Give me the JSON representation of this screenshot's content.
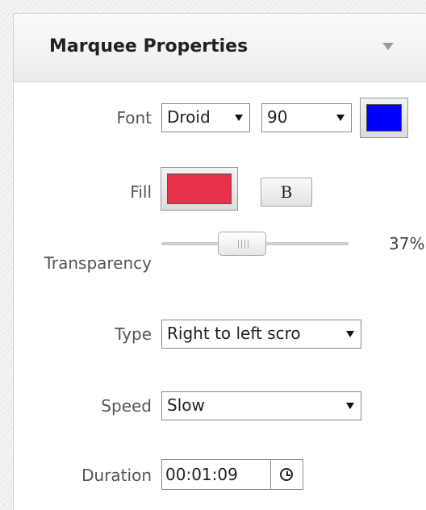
{
  "panel": {
    "title": "Marquee Properties"
  },
  "font": {
    "label": "Font",
    "family": "Droid",
    "size": "90",
    "color": "#0000ff"
  },
  "fill": {
    "label": "Fill",
    "color": "#e8324a",
    "bold_label": "B"
  },
  "transparency": {
    "label": "Transparency",
    "value_text": "37%",
    "value": 37
  },
  "type": {
    "label": "Type",
    "value": "Right to left scro"
  },
  "speed": {
    "label": "Speed",
    "value": "Slow"
  },
  "duration": {
    "label": "Duration",
    "value": "00:01:09"
  }
}
